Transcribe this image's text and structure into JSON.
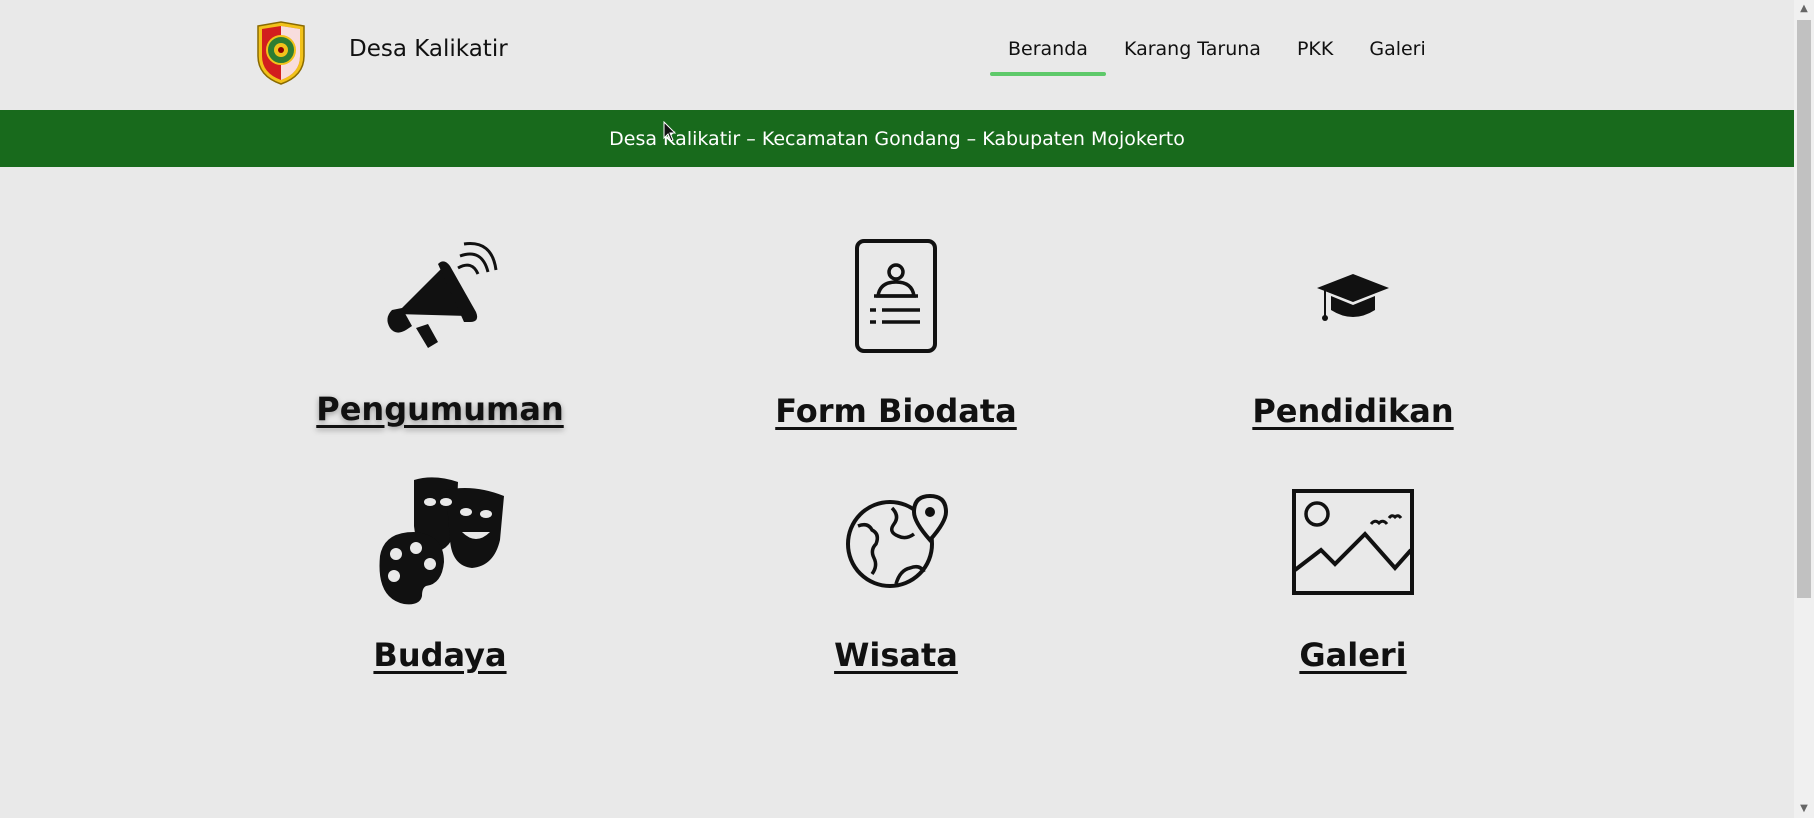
{
  "header": {
    "site_title": "Desa Kalikatir",
    "logo_icon": "village-emblem-icon"
  },
  "nav": {
    "items": [
      {
        "label": "Beranda",
        "active": true
      },
      {
        "label": "Karang Taruna",
        "active": false
      },
      {
        "label": "PKK",
        "active": false
      },
      {
        "label": "Galeri",
        "active": false
      }
    ],
    "active_underline_color": "#5ec96a"
  },
  "banner": {
    "text": "Desa Kalikatir – Kecamatan Gondang – Kabupaten Mojokerto",
    "background_color": "#186a1c"
  },
  "menu": {
    "items": [
      {
        "label": "Pengumuman",
        "icon": "megaphone-icon"
      },
      {
        "label": "Form Biodata",
        "icon": "id-card-icon"
      },
      {
        "label": "Pendidikan",
        "icon": "graduation-cap-icon"
      },
      {
        "label": "Budaya",
        "icon": "theater-masks-icon"
      },
      {
        "label": "Wisata",
        "icon": "globe-location-icon"
      },
      {
        "label": "Galeri",
        "icon": "image-icon"
      }
    ]
  }
}
